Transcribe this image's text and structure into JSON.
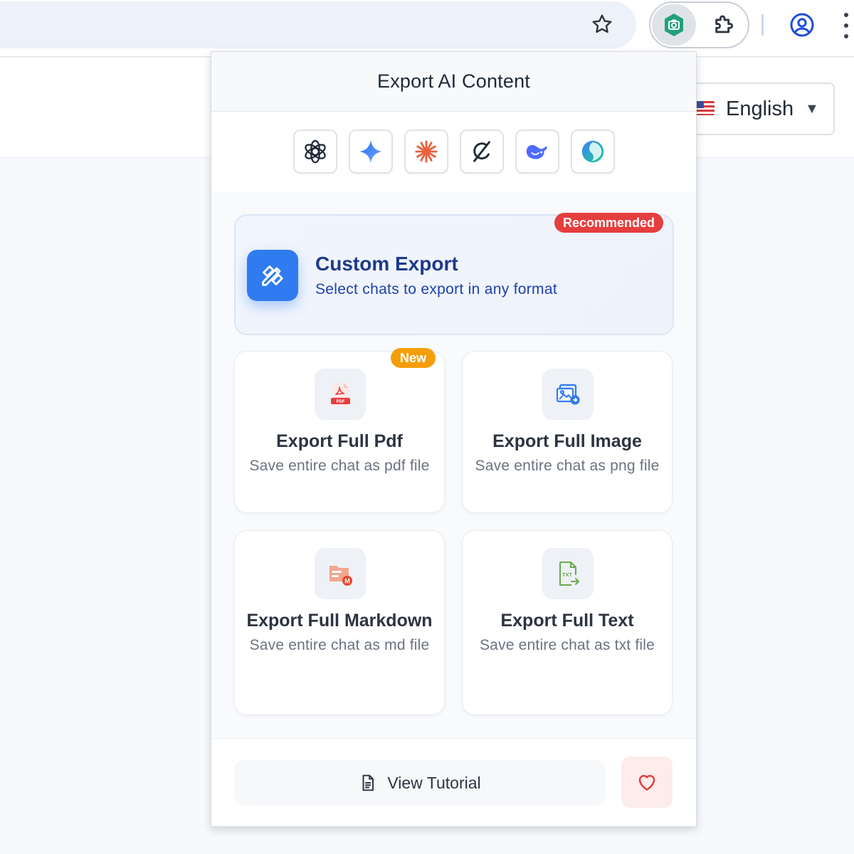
{
  "browser": {
    "toolbar_icons": [
      "star-icon",
      "extension-export-icon",
      "puzzle-icon",
      "profile-icon",
      "more-vert-icon"
    ]
  },
  "page": {
    "language_select": {
      "flag": "us-flag-icon",
      "value": "English",
      "caret": "▼"
    }
  },
  "popup": {
    "title": "Export AI Content",
    "platforms": [
      {
        "icon": "chatgpt-icon",
        "color": "#1f2937"
      },
      {
        "icon": "gemini-icon",
        "color": "#3b82f6"
      },
      {
        "icon": "claude-icon",
        "color": "#e8603c"
      },
      {
        "icon": "grok-icon",
        "color": "#1f2937"
      },
      {
        "icon": "deepseek-icon",
        "color": "#4d6bfe"
      },
      {
        "icon": "perplexity-icon",
        "color": "#20b486"
      }
    ],
    "custom_export": {
      "badge": "Recommended",
      "title": "Custom Export",
      "subtitle": "Select chats to export in any format",
      "icon": "pencil-ruler-icon",
      "badge_color": "#e53e3e",
      "accent": "#2f7bef"
    },
    "cards": {
      "pdf": {
        "badge": "New",
        "title": "Export Full Pdf",
        "subtitle": "Save entire chat as pdf file",
        "icon": "pdf-file-icon"
      },
      "image": {
        "title": "Export Full Image",
        "subtitle": "Save entire chat as png file",
        "icon": "image-file-icon"
      },
      "markdown": {
        "title": "Export Full Markdown",
        "subtitle": "Save entire chat as md file",
        "icon": "markdown-file-icon"
      },
      "text": {
        "title": "Export Full Text",
        "subtitle": "Save entire chat as txt file",
        "icon": "txt-file-icon"
      }
    },
    "footer": {
      "tutorial_label": "View Tutorial",
      "tutorial_icon": "document-icon",
      "favorite_icon": "heart-icon",
      "heart_color": "#e53e3e"
    }
  }
}
